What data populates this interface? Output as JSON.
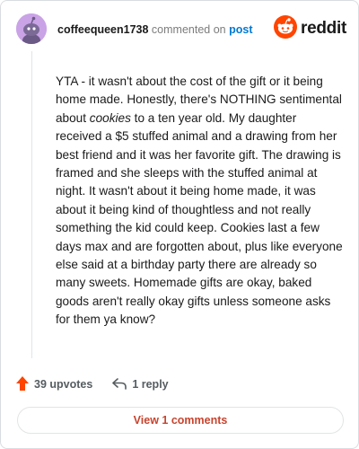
{
  "header": {
    "username": "coffeequeen1738",
    "commented_text": "commented on",
    "post_link": "post",
    "brand": "reddit"
  },
  "comment": {
    "part1": "YTA - it wasn't about the cost of the gift or it being home made. Honestly, there's NOTHING sentimental about ",
    "emphasis": "cookies",
    "part2": " to a ten year old. My daughter received a $5 stuffed animal and a drawing from her best friend and it was her favorite gift. The drawing is framed and she sleeps with the stuffed animal at night. It wasn't about it being home made, it was about it being kind of thoughtless and not really something the kid could keep. Cookies last a few days max and are forgotten about, plus like everyone else said at a birthday party there are already so many sweets. Homemade gifts are okay, baked goods aren't really okay gifts unless someone asks for them ya know?"
  },
  "actions": {
    "upvotes": "39 upvotes",
    "replies": "1 reply"
  },
  "view_comments_label": "View 1 comments",
  "colors": {
    "accent_orange": "#ff4500",
    "link_blue": "#0079d3",
    "view_button_text": "#c7442e",
    "avatar_bg": "#c9a3e6"
  },
  "icons": {
    "avatar": "snoo-avatar-icon",
    "logo": "reddit-snoo-icon",
    "upvote": "upvote-arrow-icon",
    "reply": "reply-arrow-icon"
  }
}
